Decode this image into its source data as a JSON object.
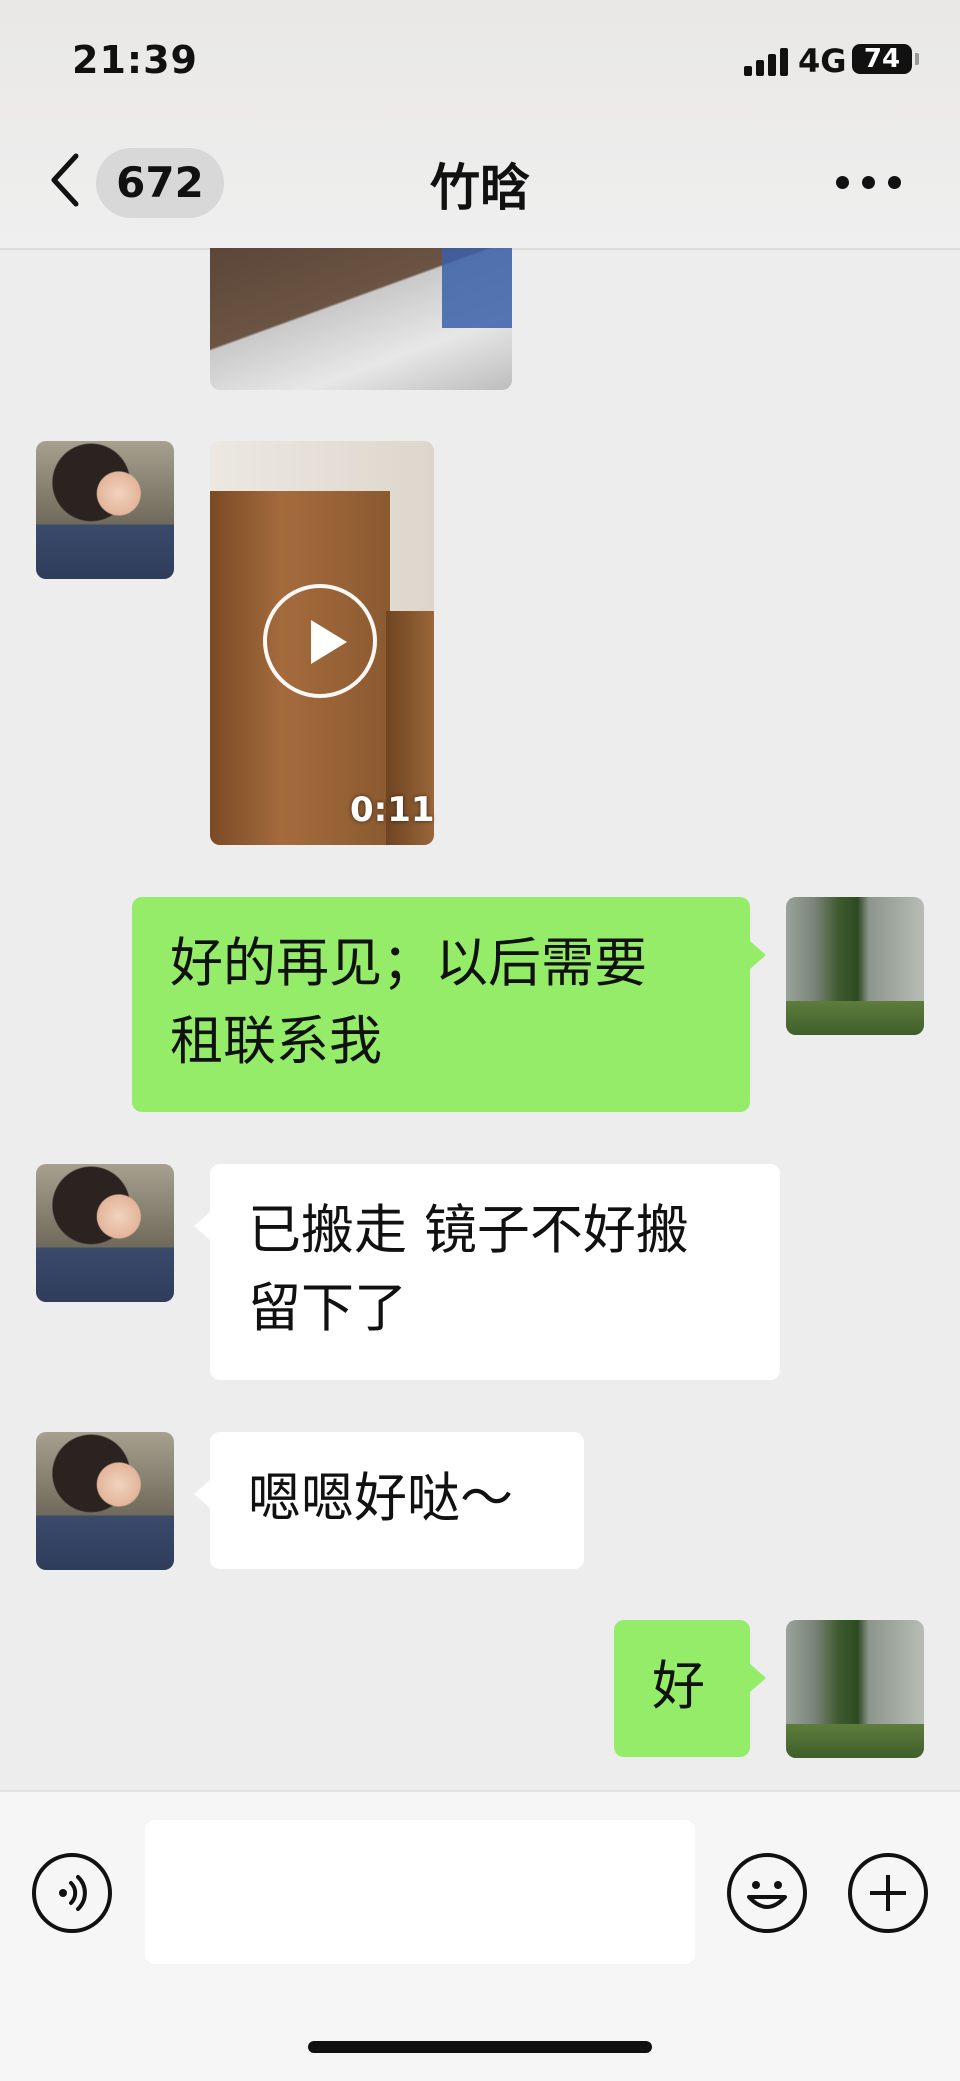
{
  "status_bar": {
    "time": "21:39",
    "network": "4G",
    "battery": "74"
  },
  "header": {
    "unread_count": "672",
    "title": "竹晗"
  },
  "messages": [
    {
      "type": "image",
      "sender": "them"
    },
    {
      "type": "video",
      "sender": "them",
      "duration": "0:11"
    },
    {
      "type": "text",
      "sender": "me",
      "lines": [
        "好的再见；以后需要",
        "租联系我"
      ]
    },
    {
      "type": "text",
      "sender": "them",
      "lines": [
        "已搬走 镜子不好搬",
        "留下了"
      ]
    },
    {
      "type": "text",
      "sender": "them",
      "lines": [
        "嗯嗯好哒～"
      ]
    },
    {
      "type": "text",
      "sender": "me",
      "lines": [
        "好"
      ]
    }
  ],
  "input_bar": {
    "value": ""
  },
  "colors": {
    "my_bubble": "#95ec69",
    "their_bubble": "#ffffff",
    "background": "#ededed"
  },
  "icons": [
    "back-chevron-icon",
    "more-dots-icon",
    "play-icon",
    "voice-icon",
    "emoji-icon",
    "plus-icon"
  ]
}
